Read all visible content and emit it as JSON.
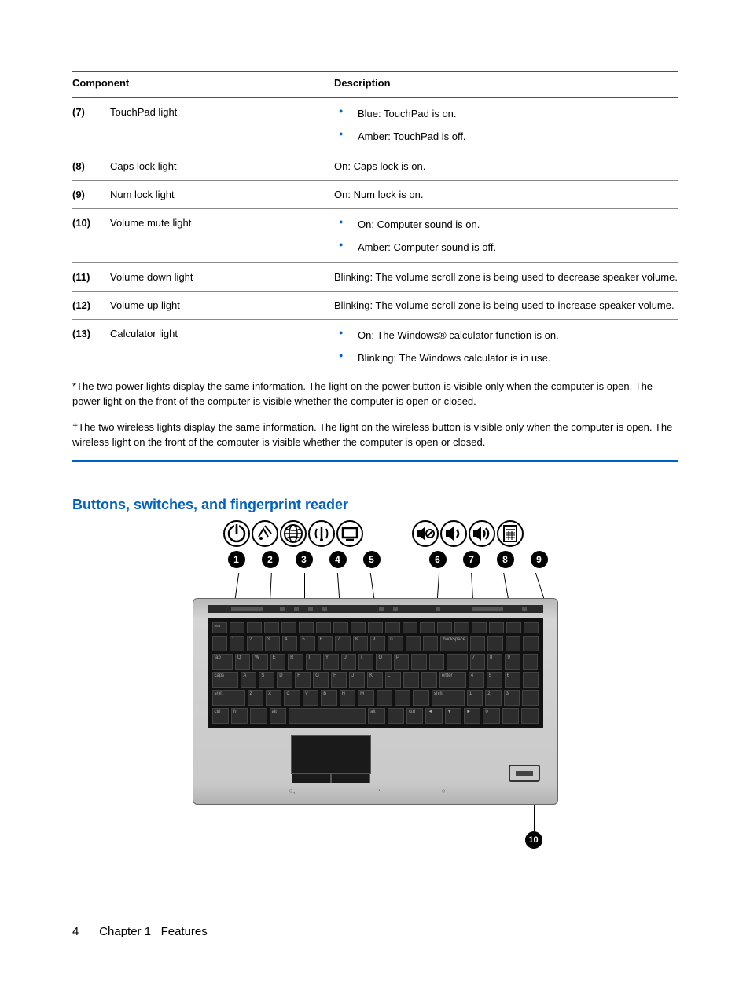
{
  "table": {
    "headers": {
      "component": "Component",
      "description": "Description"
    },
    "rows": [
      {
        "idx": "(7)",
        "component": "TouchPad light",
        "type": "list",
        "items": [
          "Blue: TouchPad is on.",
          "Amber: TouchPad is off."
        ]
      },
      {
        "idx": "(8)",
        "component": "Caps lock light",
        "type": "text",
        "text": "On: Caps lock is on."
      },
      {
        "idx": "(9)",
        "component": "Num lock light",
        "type": "text",
        "text": "On: Num lock is on."
      },
      {
        "idx": "(10)",
        "component": "Volume mute light",
        "type": "list",
        "items": [
          "On: Computer sound is on.",
          "Amber: Computer sound is off."
        ]
      },
      {
        "idx": "(11)",
        "component": "Volume down light",
        "type": "text",
        "text": "Blinking: The volume scroll zone is being used to decrease speaker volume."
      },
      {
        "idx": "(12)",
        "component": "Volume up light",
        "type": "text",
        "text": "Blinking: The volume scroll zone is being used to increase speaker volume."
      },
      {
        "idx": "(13)",
        "component": "Calculator light",
        "type": "list",
        "items": [
          "On: The Windows® calculator function is on.",
          "Blinking: The Windows calculator is in use."
        ]
      }
    ]
  },
  "footnotes": {
    "note1": "*The two power lights display the same information. The light on the power button is visible only when the computer is open. The power light on the front of the computer is visible whether the computer is open or closed.",
    "note2": "†The two wireless lights display the same information. The light on the wireless button is visible only when the computer is open. The wireless light on the front of the computer is visible whether the computer is open or closed."
  },
  "section_heading": "Buttons, switches, and fingerprint reader",
  "callouts": {
    "c1": "1",
    "c2": "2",
    "c3": "3",
    "c4": "4",
    "c5": "5",
    "c6": "6",
    "c7": "7",
    "c8": "8",
    "c9": "9",
    "c10": "10"
  },
  "footer": {
    "page": "4",
    "chapter": "Chapter 1",
    "title": "Features"
  }
}
